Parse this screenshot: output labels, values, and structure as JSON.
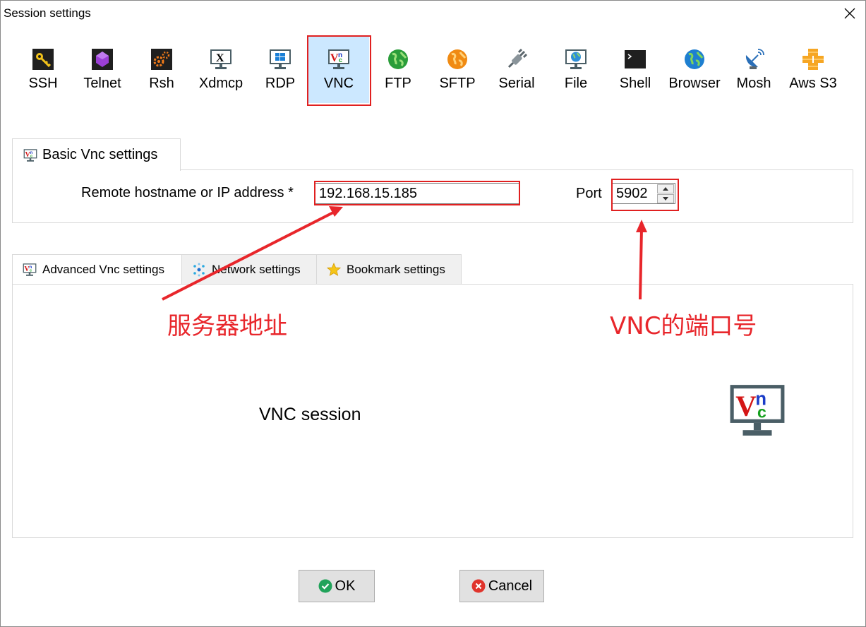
{
  "window": {
    "title": "Session settings"
  },
  "session_types": [
    {
      "label": "SSH",
      "icon": "key-icon"
    },
    {
      "label": "Telnet",
      "icon": "gem-icon"
    },
    {
      "label": "Rsh",
      "icon": "gears-icon"
    },
    {
      "label": "Xdmcp",
      "icon": "x-monitor-icon"
    },
    {
      "label": "RDP",
      "icon": "windows-monitor-icon"
    },
    {
      "label": "VNC",
      "icon": "vnc-monitor-icon",
      "selected": true
    },
    {
      "label": "FTP",
      "icon": "green-globe-icon"
    },
    {
      "label": "SFTP",
      "icon": "orange-globe-icon"
    },
    {
      "label": "Serial",
      "icon": "plug-icon"
    },
    {
      "label": "File",
      "icon": "globe-monitor-icon"
    },
    {
      "label": "Shell",
      "icon": "terminal-icon"
    },
    {
      "label": "Browser",
      "icon": "blue-globe-icon"
    },
    {
      "label": "Mosh",
      "icon": "satellite-dish-icon"
    },
    {
      "label": "Aws S3",
      "icon": "cubes-icon"
    }
  ],
  "basic": {
    "tab_label": "Basic Vnc settings",
    "host_label": "Remote hostname or IP address *",
    "host_value": "192.168.15.185",
    "port_label": "Port",
    "port_value": "5902"
  },
  "sub_tabs": [
    {
      "label": "Advanced Vnc settings",
      "icon": "vnc-monitor-icon",
      "active": true
    },
    {
      "label": "Network settings",
      "icon": "network-icon"
    },
    {
      "label": "Bookmark settings",
      "icon": "star-icon"
    }
  ],
  "content": {
    "text": "VNC session"
  },
  "annotations": {
    "host": "服务器地址",
    "port": "VNC的端口号",
    "color": "#e8262b"
  },
  "buttons": {
    "ok": "OK",
    "cancel": "Cancel"
  },
  "colors": {
    "selected_bg": "#cce8ff",
    "highlight": "#e02020"
  }
}
